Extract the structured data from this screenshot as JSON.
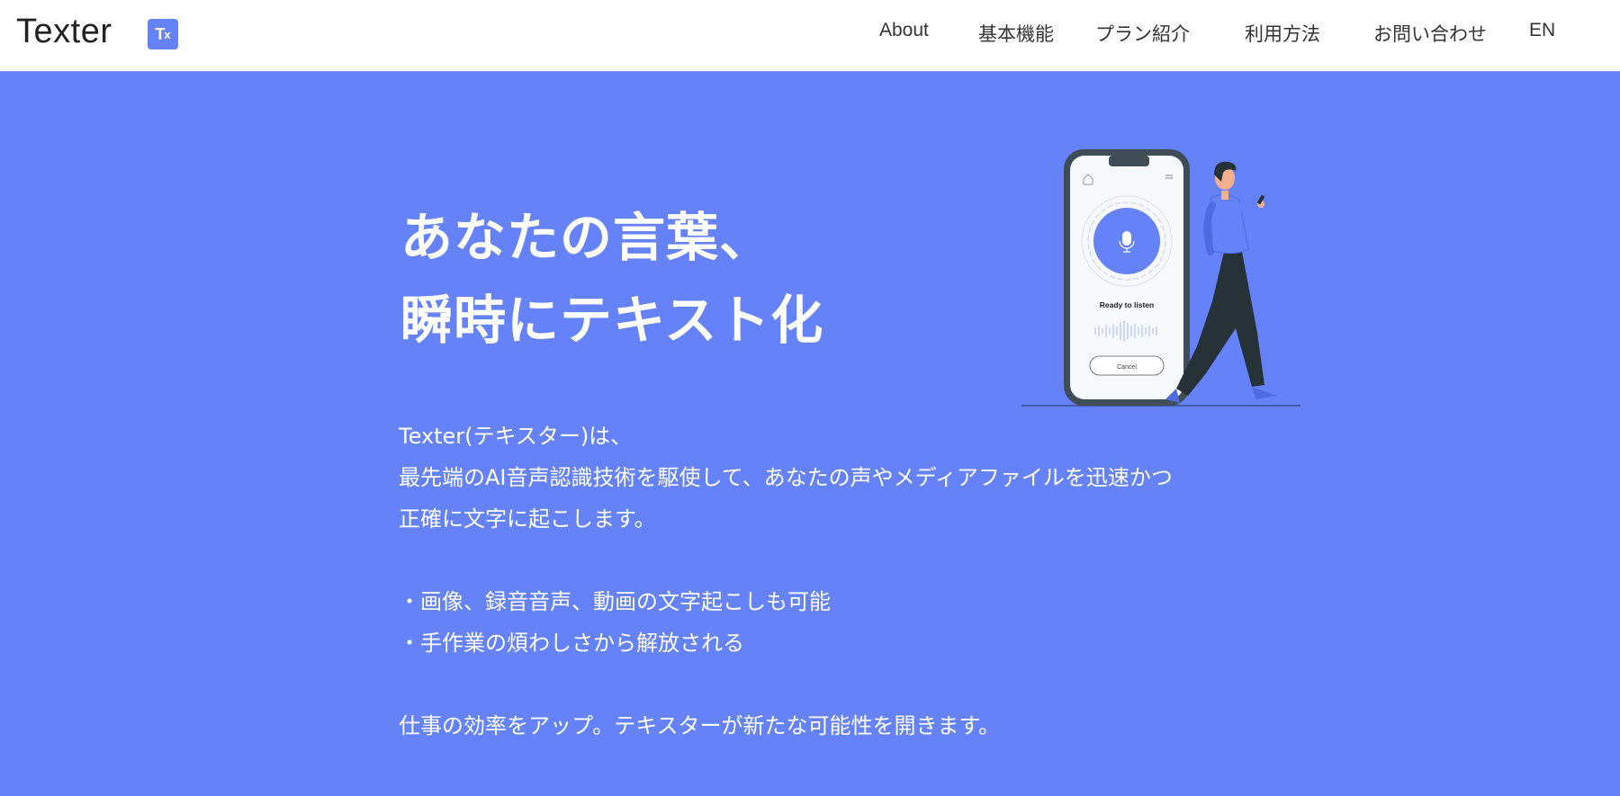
{
  "header": {
    "brand": "Texter",
    "logo_icon": "texter-logo-icon",
    "logo_text": "T",
    "logo_sub": "x",
    "nav": [
      {
        "label": "About"
      },
      {
        "label": "基本機能"
      },
      {
        "label": "プラン紹介"
      },
      {
        "label": "利用方法"
      },
      {
        "label": "お問い合わせ"
      },
      {
        "label": "EN"
      }
    ]
  },
  "hero": {
    "title_lines": [
      "あなたの言葉、",
      "瞬時にテキスト化"
    ],
    "intro_lines": [
      "Texter(テキスター)は、",
      "最先端のAI音声認識技術を駆使して、あなたの声やメディアファイルを迅速かつ",
      "正確に文字に起こします。"
    ],
    "bullets": [
      "・画像、録音音声、動画の文字起こしも可能",
      "・手作業の煩わしさから解放される"
    ],
    "closing": "仕事の効率をアップ。テキスターが新たな可能性を開きます。"
  },
  "illustration": {
    "phone_status": "Ready to listen",
    "phone_button": "Cancel",
    "icons": [
      "home-icon",
      "menu-icon",
      "microphone-icon"
    ]
  },
  "colors": {
    "accent": "#6582f8",
    "header_bg": "#ffffff",
    "text_dark": "#333333"
  }
}
